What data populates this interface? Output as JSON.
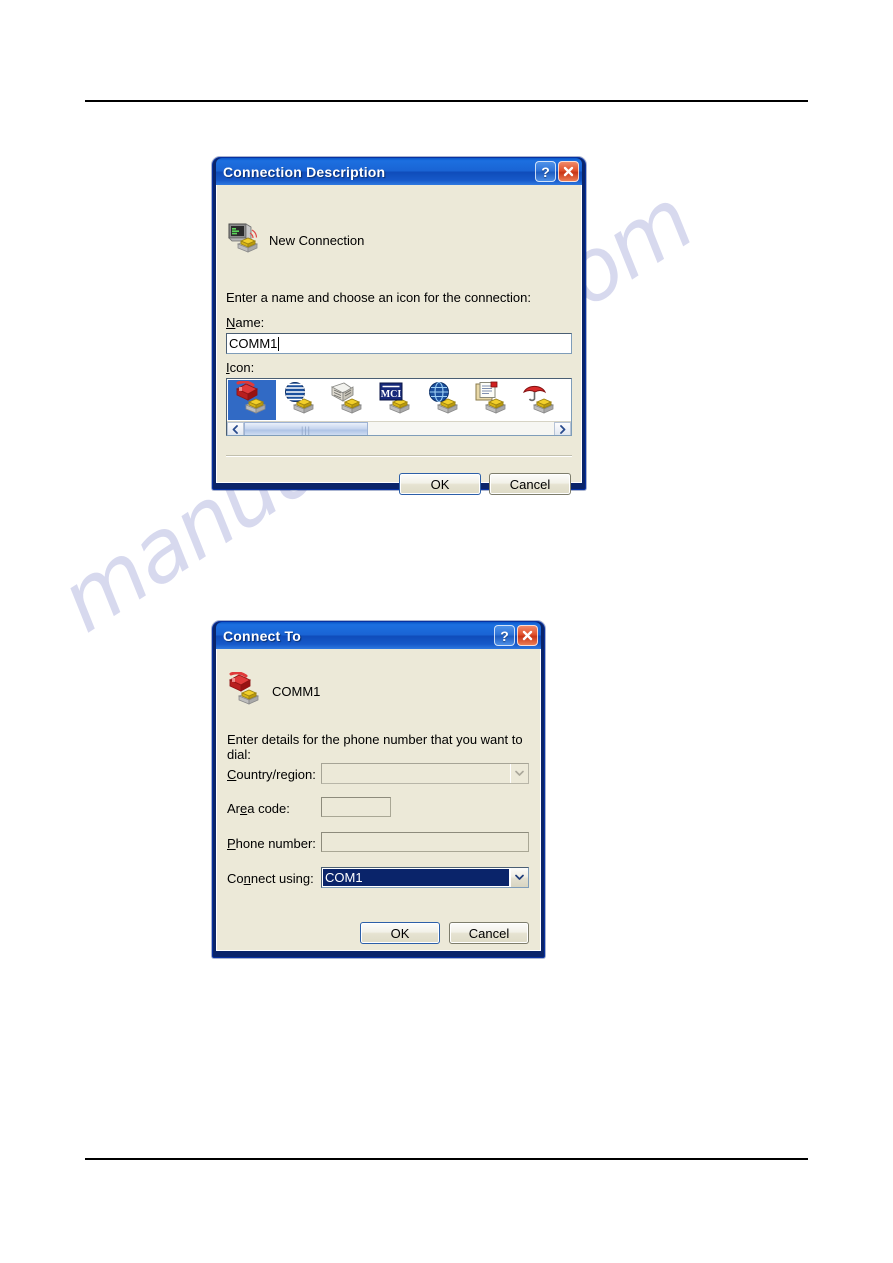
{
  "page": {
    "watermark": "manualshive.com",
    "background_color": "#ffffff",
    "rule_color": "#000000"
  },
  "dialog1": {
    "title": "Connection Description",
    "titlebar_help_label": "?",
    "titlebar_close_label": "×",
    "header_icon": "new-connection-computer-phone-icon",
    "header_label": "New Connection",
    "instruction": "Enter a name and choose an icon for the connection:",
    "name_label_prefix": "N",
    "name_label_rest": "ame:",
    "name_value": "COMM1",
    "icon_label_prefix": "I",
    "icon_label_rest": "con:",
    "icons": [
      {
        "name": "red-telephone-icon",
        "selected": true
      },
      {
        "name": "blue-striped-globe-icon",
        "selected": false
      },
      {
        "name": "newspaper-icon",
        "selected": false
      },
      {
        "name": "mci-logo-icon",
        "selected": false
      },
      {
        "name": "blue-globe-network-icon",
        "selected": false
      },
      {
        "name": "document-notepad-icon",
        "selected": false
      },
      {
        "name": "red-umbrella-icon",
        "selected": false
      }
    ],
    "scroll_left_glyph": "‹",
    "scroll_right_glyph": "›",
    "ok_label": "OK",
    "cancel_label": "Cancel"
  },
  "dialog2": {
    "title": "Connect To",
    "titlebar_help_label": "?",
    "titlebar_close_label": "×",
    "header_icon": "red-telephone-icon",
    "header_label": "COMM1",
    "instruction": "Enter details for the phone number that you want to dial:",
    "fields": [
      {
        "name": "country-region",
        "label_pre": "C",
        "label_accel": "",
        "label_post": "ountry/region:",
        "value": "",
        "control": "combo-disabled"
      },
      {
        "name": "area-code",
        "label_pre": "Ar",
        "label_accel": "e",
        "label_post": "a code:",
        "value": "",
        "control": "textbox-small"
      },
      {
        "name": "phone-number",
        "label_pre": "P",
        "label_accel": "",
        "label_post": "hone number:",
        "value": "",
        "control": "textbox-wide"
      },
      {
        "name": "connect-using",
        "label_pre": "Co",
        "label_accel": "n",
        "label_post": "nect using:",
        "value": "COM1",
        "control": "combo-selected"
      }
    ],
    "ok_label": "OK",
    "cancel_label": "Cancel"
  }
}
